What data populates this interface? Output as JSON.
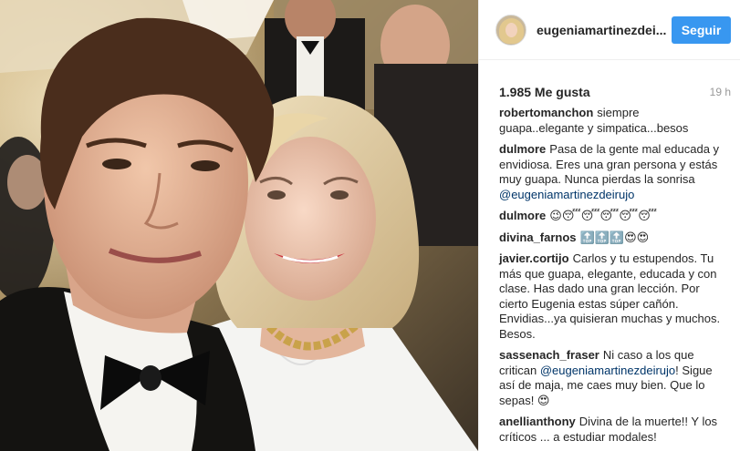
{
  "post": {
    "username": "eugeniamartinezdei...",
    "follow_label": "Seguir",
    "likes": "1.985 Me gusta",
    "time_ago": "19 h"
  },
  "comments": [
    {
      "user": "robertomanchon",
      "text": "siempre guapa..elegante y simpatica...besos",
      "mention": ""
    },
    {
      "user": "dulmore",
      "text": "Pasa de la gente mal educada y envidiosa. Eres una gran persona y estás muy guapa. Nunca pierdas la sonrisa",
      "mention": "@eugeniamartinezdeirujo"
    },
    {
      "user": "dulmore",
      "text": "😉😴😴😴😴😴",
      "mention": ""
    },
    {
      "user": "divina_farnos",
      "text": "🔝🔝🔝😍😍",
      "mention": ""
    },
    {
      "user": "javier.cortijo",
      "text": "Carlos y tu estupendos. Tu más que guapa, elegante, educada y con clase. Has dado una gran lección. Por cierto Eugenia estas súper cañón. Envidias...ya quisieran muchas y muchos. Besos.",
      "mention": ""
    },
    {
      "user": "sassenach_fraser",
      "text": "Ni caso a los que critican",
      "mention": "@eugeniamartinezdeirujo",
      "text_after": "! Sigue así de maja, me caes muy bien. Que lo sepas! 😍"
    },
    {
      "user": "anellianthony",
      "text": "Divina de la muerte!! Y los críticos ... a estudiar modales!",
      "mention": ""
    }
  ],
  "icons": {
    "avatar": "profile-avatar"
  }
}
